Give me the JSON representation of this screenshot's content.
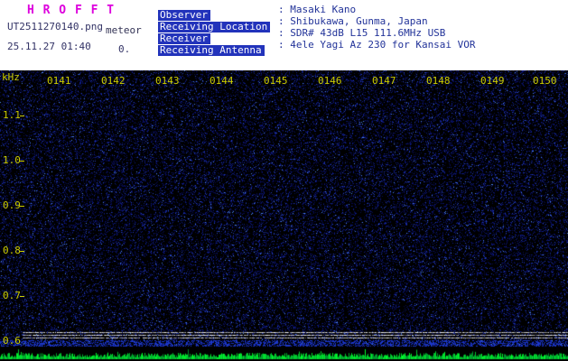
{
  "header": {
    "app_title": "H R O F F T",
    "filename": "UT2511270140.png",
    "mode": "meteor",
    "timestamp": "25.11.27 01:40",
    "frame_counter": "0.",
    "info": [
      {
        "label": "Observer",
        "value": ": Masaki Kano"
      },
      {
        "label": "Receiving Location",
        "value": ": Shibukawa, Gunma, Japan"
      },
      {
        "label": "Receiver",
        "value": ": SDR# 43dB L15 111.6MHz USB"
      },
      {
        "label": "Receiving Antenna",
        "value": ": 4ele Yagi Az 230 for Kansai VOR"
      }
    ]
  },
  "chart_data": {
    "type": "heatmap",
    "title": "",
    "ylabel": "kHz",
    "y_ticks": [
      "1.1",
      "1.0",
      "0.9",
      "0.8",
      "0.7",
      "0.6"
    ],
    "y_range_khz": [
      0.56,
      1.2
    ],
    "x_ticks": [
      "0141",
      "0142",
      "0143",
      "0144",
      "0145",
      "0146",
      "0147",
      "0148",
      "0149",
      "0150"
    ],
    "x_range_ut": [
      "01:40",
      "01:50"
    ],
    "content": "uniform blue background noise speckle, no meteor echo traces visible",
    "carrier_lines_khz": [
      0.62,
      0.614,
      0.608
    ],
    "bottom_trace": "green signal-level noise trace along bottom edge",
    "colors": {
      "plot_background": "#000000",
      "noise_speckle": "#10309a",
      "noise_bright": "#508cff",
      "axis_text": "#cccc00",
      "carrier_line": "#c8c8c8",
      "level_trace": "#00aa33",
      "header_background": "#ffffff",
      "app_title": "#dd00dd",
      "info_label_bg": "#2233bb",
      "info_text": "#223399"
    }
  }
}
